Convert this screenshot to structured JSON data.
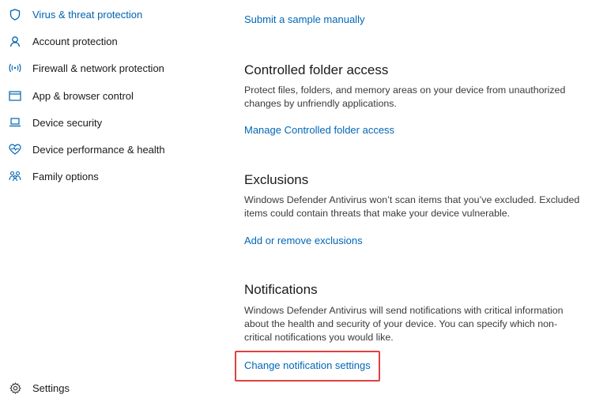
{
  "sidebar": {
    "items": [
      {
        "label": "Virus & threat protection",
        "icon": "shield-icon",
        "active": true
      },
      {
        "label": "Account protection",
        "icon": "person-icon"
      },
      {
        "label": "Firewall & network protection",
        "icon": "wifi-antenna-icon"
      },
      {
        "label": "App & browser control",
        "icon": "app-window-icon"
      },
      {
        "label": "Device security",
        "icon": "laptop-icon"
      },
      {
        "label": "Device performance & health",
        "icon": "heart-icon"
      },
      {
        "label": "Family options",
        "icon": "family-icon"
      }
    ],
    "settings": {
      "label": "Settings",
      "icon": "gear-icon"
    }
  },
  "main": {
    "submit_sample_link": "Submit a sample manually",
    "controlled_folder": {
      "title": "Controlled folder access",
      "description": "Protect files, folders, and memory areas on your device from unauthorized changes by unfriendly applications.",
      "link": "Manage Controlled folder access"
    },
    "exclusions": {
      "title": "Exclusions",
      "description": "Windows Defender Antivirus won’t scan items that you’ve excluded. Excluded items could contain threats that make your device vulnerable.",
      "link": "Add or remove exclusions"
    },
    "notifications": {
      "title": "Notifications",
      "description": "Windows Defender Antivirus will send notifications with critical information about the health and security of your device.  You can specify which non-critical notifications you would like.",
      "link": "Change notification settings"
    }
  },
  "colors": {
    "accent": "#0067b8",
    "active_nav": "#0063b1",
    "highlight": "#e04040"
  }
}
